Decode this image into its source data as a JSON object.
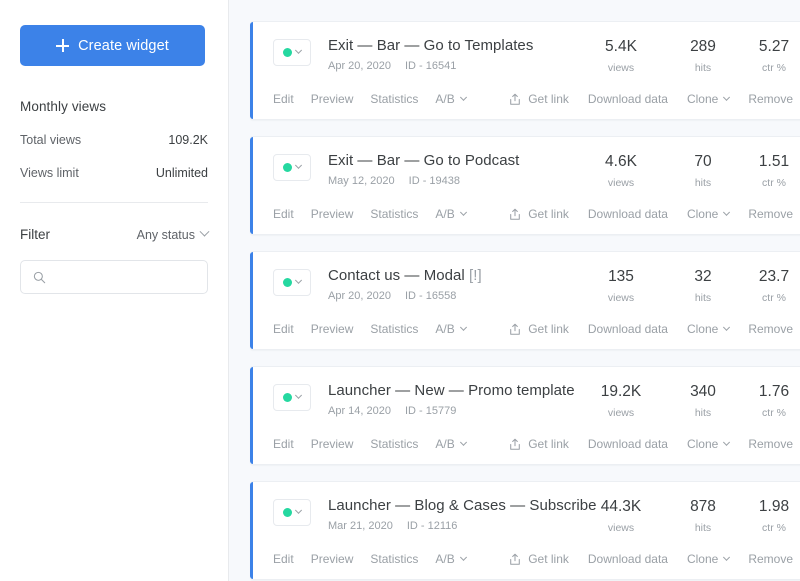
{
  "sidebar": {
    "create_button": "Create widget",
    "monthly_views_title": "Monthly views",
    "stats": [
      {
        "label": "Total views",
        "value": "109.2K"
      },
      {
        "label": "Views limit",
        "value": "Unlimited"
      }
    ],
    "filter_label": "Filter",
    "filter_value": "Any status",
    "search_placeholder": ""
  },
  "colors": {
    "accent_blue": "#3c82e8",
    "status_green": "#25d8a0",
    "content_bg": "#f7f9fc",
    "text_primary": "#3c4043",
    "text_muted": "#9aa0a6"
  },
  "actions": {
    "edit": "Edit",
    "preview": "Preview",
    "statistics": "Statistics",
    "ab": "A/B",
    "get_link": "Get link",
    "download_data": "Download data",
    "clone": "Clone",
    "remove": "Remove"
  },
  "metric_labels": {
    "views": "views",
    "hits": "hits",
    "ctr": "ctr %"
  },
  "widgets": [
    {
      "title": "Exit — Bar — Go to Templates",
      "title_suffix": "",
      "date": "Apr 20, 2020",
      "id": "ID - 16541",
      "views": "5.4K",
      "hits": "289",
      "ctr": "5.27",
      "status": "active"
    },
    {
      "title": "Exit — Bar — Go to Podcast",
      "title_suffix": "",
      "date": "May 12, 2020",
      "id": "ID - 19438",
      "views": "4.6K",
      "hits": "70",
      "ctr": "1.51",
      "status": "active"
    },
    {
      "title": "Contact us — Modal ",
      "title_suffix": "[!]",
      "date": "Apr 20, 2020",
      "id": "ID - 16558",
      "views": "135",
      "hits": "32",
      "ctr": "23.7",
      "status": "active"
    },
    {
      "title": "Launcher — New — Promo template",
      "title_suffix": "",
      "date": "Apr 14, 2020",
      "id": "ID - 15779",
      "views": "19.2K",
      "hits": "340",
      "ctr": "1.76",
      "status": "active"
    },
    {
      "title": "Launcher — Blog & Cases — Subscribe",
      "title_suffix": "",
      "date": "Mar 21, 2020",
      "id": "ID - 12116",
      "views": "44.3K",
      "hits": "878",
      "ctr": "1.98",
      "status": "active"
    }
  ]
}
